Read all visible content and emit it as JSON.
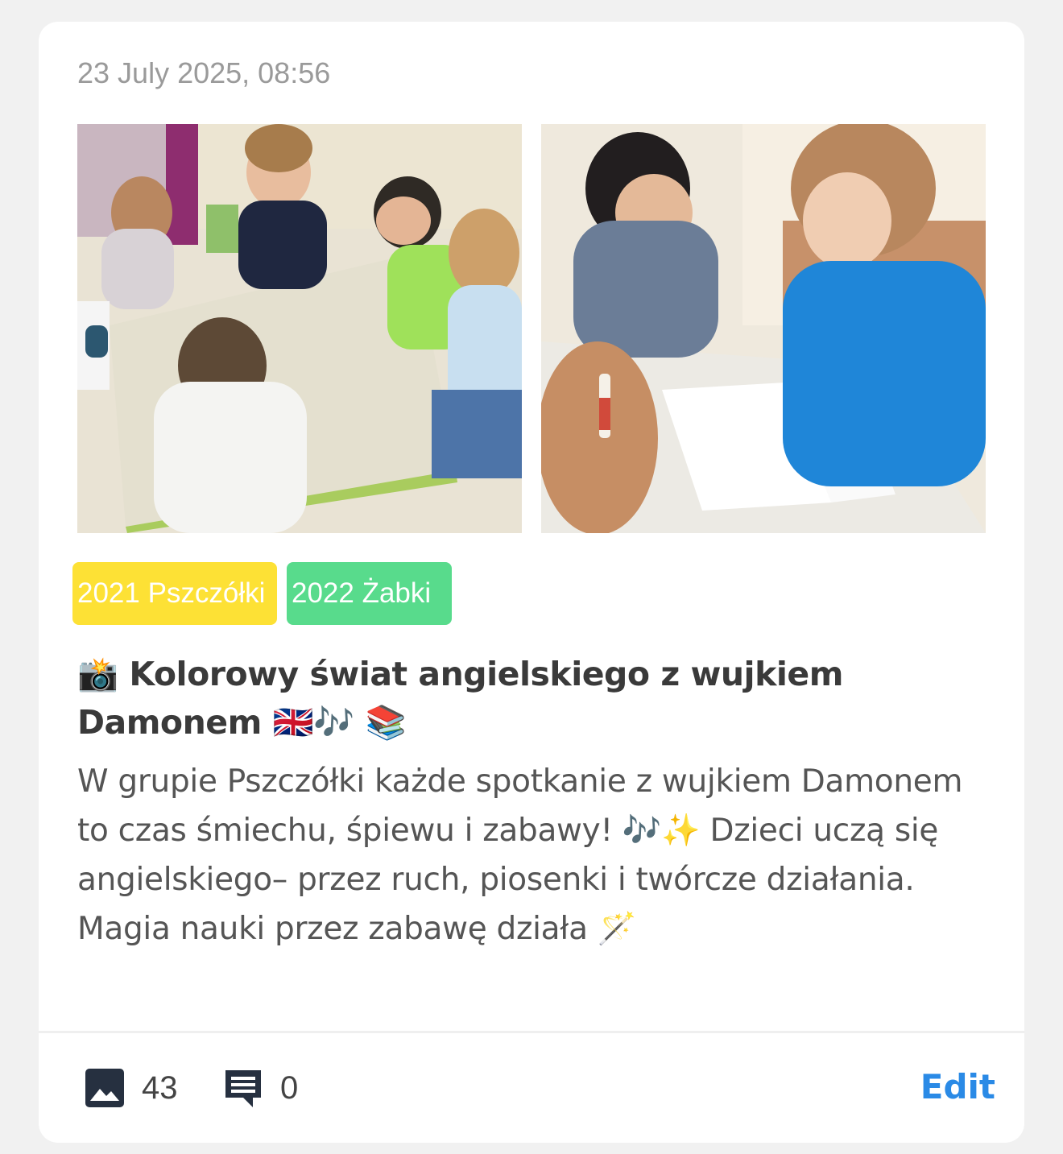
{
  "post": {
    "timestamp": "23 July 2025, 08:56",
    "photos": [
      {
        "icon": "photo-children-at-table"
      },
      {
        "icon": "photo-children-cutting-butterfly"
      }
    ],
    "tags": [
      {
        "label": "2021 Pszczółki",
        "color": "#fde135"
      },
      {
        "label": "2022 Żabki",
        "color": "#58db8c"
      }
    ],
    "title": "📸 Kolorowy świat angielskiego z wujkiem Damonem 🇬🇧🎶 📚",
    "body": "W grupie Pszczółki każde spotkanie z wujkiem Damonem to czas śmiechu, śpiewu i zabawy! 🎶✨ Dzieci uczą się angielskiego– przez ruch, piosenki i twórcze działania. Magia nauki przez zabawę działa 🪄"
  },
  "footer": {
    "photo_count": "43",
    "comment_count": "0",
    "edit_label": "Edit",
    "accent": "#2a8ae6"
  }
}
